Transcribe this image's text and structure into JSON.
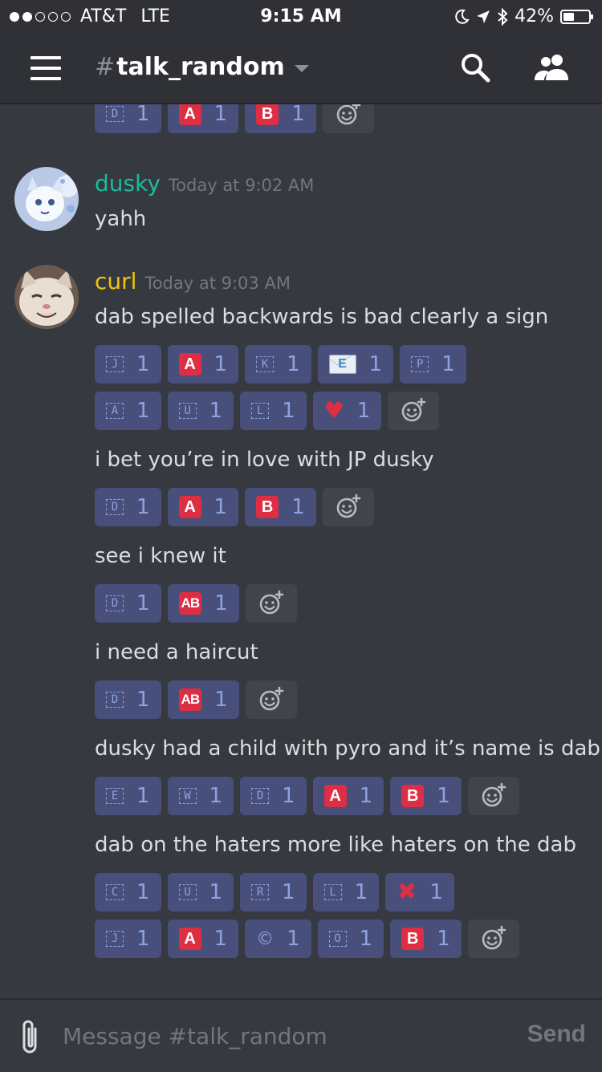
{
  "status_bar": {
    "carrier": "AT&T",
    "network": "LTE",
    "time": "9:15 AM",
    "battery_percent": "42%",
    "battery_level": 0.42,
    "signal_bars_filled": 2,
    "signal_bars_total": 5
  },
  "header": {
    "channel_hash": "#",
    "channel_name": "talk_random"
  },
  "messages": {
    "top_reactions": [
      {
        "emoji": "D",
        "kind": "letter",
        "count": "1"
      },
      {
        "emoji": "A",
        "kind": "red",
        "count": "1"
      },
      {
        "emoji": "B",
        "kind": "red",
        "count": "1"
      }
    ],
    "dusky": {
      "username": "dusky",
      "timestamp": "Today at 9:02 AM",
      "color": "#1abc9c",
      "text": "yahh"
    },
    "curl": {
      "username": "curl",
      "timestamp": "Today at 9:03 AM",
      "color": "#f1c40f",
      "m1_text": "dab spelled backwards is bad clearly a sign",
      "m1_r1": [
        {
          "emoji": "J",
          "kind": "letter",
          "count": "1"
        },
        {
          "emoji": "A",
          "kind": "red",
          "count": "1"
        },
        {
          "emoji": "K",
          "kind": "letter",
          "count": "1"
        },
        {
          "emoji": "E",
          "kind": "mail",
          "count": "1"
        },
        {
          "emoji": "P",
          "kind": "letter",
          "count": "1"
        }
      ],
      "m1_r2": [
        {
          "emoji": "A",
          "kind": "letter",
          "count": "1"
        },
        {
          "emoji": "U",
          "kind": "letter",
          "count": "1"
        },
        {
          "emoji": "L",
          "kind": "letter",
          "count": "1"
        },
        {
          "emoji": "heart",
          "kind": "heart",
          "count": "1"
        }
      ],
      "m2_text": "i bet you’re in love with JP dusky",
      "m2_r1": [
        {
          "emoji": "D",
          "kind": "letter",
          "count": "1"
        },
        {
          "emoji": "A",
          "kind": "red",
          "count": "1"
        },
        {
          "emoji": "B",
          "kind": "red",
          "count": "1"
        }
      ],
      "m3_text": "see i knew it",
      "m3_r1": [
        {
          "emoji": "D",
          "kind": "letter",
          "count": "1"
        },
        {
          "emoji": "AB",
          "kind": "red",
          "count": "1"
        }
      ],
      "m4_text": "i need a haircut",
      "m4_r1": [
        {
          "emoji": "D",
          "kind": "letter",
          "count": "1"
        },
        {
          "emoji": "AB",
          "kind": "red",
          "count": "1"
        }
      ],
      "m5_text": "dusky had a child with pyro and it’s name is dab",
      "m5_r1": [
        {
          "emoji": "E",
          "kind": "letter",
          "count": "1"
        },
        {
          "emoji": "W",
          "kind": "letter",
          "count": "1"
        },
        {
          "emoji": "D",
          "kind": "letter",
          "count": "1"
        },
        {
          "emoji": "A",
          "kind": "red",
          "count": "1"
        },
        {
          "emoji": "B",
          "kind": "red",
          "count": "1"
        }
      ],
      "m6_text": "dab on the haters more like haters on the dab",
      "m6_r1": [
        {
          "emoji": "C",
          "kind": "letter",
          "count": "1"
        },
        {
          "emoji": "U",
          "kind": "letter",
          "count": "1"
        },
        {
          "emoji": "R",
          "kind": "letter",
          "count": "1"
        },
        {
          "emoji": "L",
          "kind": "letter",
          "count": "1"
        },
        {
          "emoji": "x",
          "kind": "x",
          "count": "1"
        }
      ],
      "m6_r2": [
        {
          "emoji": "J",
          "kind": "letter",
          "count": "1"
        },
        {
          "emoji": "A",
          "kind": "red",
          "count": "1"
        },
        {
          "emoji": "©",
          "kind": "copyright",
          "count": "1"
        },
        {
          "emoji": "O",
          "kind": "letter",
          "count": "1"
        },
        {
          "emoji": "B",
          "kind": "red",
          "count": "1"
        }
      ]
    }
  },
  "composer": {
    "placeholder": "Message #talk_random",
    "send_label": "Send"
  },
  "icons": {
    "menu": "hamburger-menu-icon",
    "search": "search-icon",
    "members": "members-icon",
    "add_reaction": "add-reaction-icon",
    "attach": "paperclip-icon"
  }
}
